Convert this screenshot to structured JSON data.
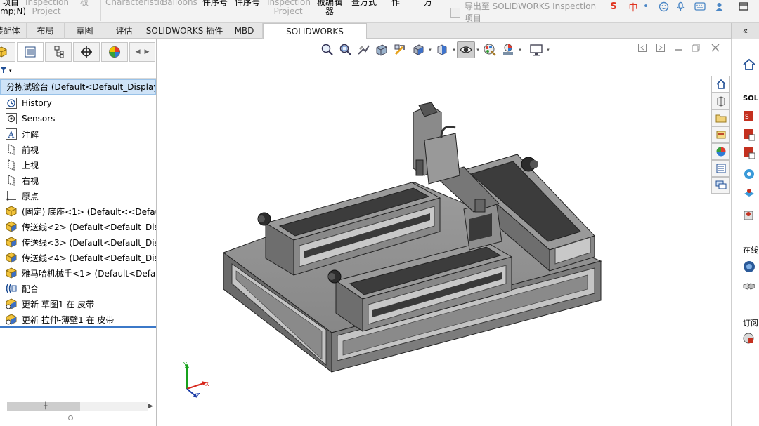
{
  "ribbon": {
    "items": [
      {
        "label": "项目\nmp;N)",
        "dim": false
      },
      {
        "label": "Inspection\nProject",
        "dim": true
      },
      {
        "label": "板",
        "dim": true
      },
      {
        "label": "Characteristic",
        "dim": true
      },
      {
        "label": "Balloons",
        "dim": true
      },
      {
        "label": "件序号",
        "dim": false
      },
      {
        "label": "件序号",
        "dim": false
      },
      {
        "label": "Inspection\nProject",
        "dim": true
      },
      {
        "label": "板编辑\n器",
        "dim": false
      },
      {
        "label": "查方式",
        "dim": false
      },
      {
        "label": "作",
        "dim": false
      },
      {
        "label": "方",
        "dim": false
      }
    ],
    "export_label": "导出至 SOLIDWORKS Inspection 项目",
    "sys_icons": [
      "sogou-ime-icon",
      "chinese-input-icon",
      "smile-icon",
      "microphone-icon",
      "keyboard-icon",
      "user-icon"
    ],
    "sys_text": {
      "s": "S",
      "zh": "中"
    }
  },
  "tabs": {
    "items": [
      "装配体",
      "布局",
      "草图",
      "评估",
      "SOLIDWORKS 插件",
      "MBD",
      "SOLIDWORKS Inspection"
    ],
    "active": 6,
    "collapse_icon": "«"
  },
  "manager": {
    "tabs": [
      "feature-manager-icon",
      "property-manager-icon",
      "configuration-manager-icon",
      "dimxpert-icon",
      "display-manager-icon"
    ],
    "filter_icon": "filter-icon",
    "root_label": "分拣试验台  (Default<Default_Display",
    "tree": [
      {
        "label": "History",
        "icon": "history-icon"
      },
      {
        "label": "Sensors",
        "icon": "sensors-icon"
      },
      {
        "label": "注解",
        "icon": "annotations-icon"
      },
      {
        "label": "前视",
        "icon": "plane-icon"
      },
      {
        "label": "上视",
        "icon": "plane-icon"
      },
      {
        "label": "右视",
        "icon": "plane-icon"
      },
      {
        "label": "原点",
        "icon": "origin-icon"
      },
      {
        "label": "(固定) 底座<1>  (Default<<Defaul",
        "icon": "part-icon"
      },
      {
        "label": "传送线<2>  (Default<Default_Disp",
        "icon": "subassembly-icon"
      },
      {
        "label": "传送线<3>  (Default<Default_Disp",
        "icon": "subassembly-icon"
      },
      {
        "label": "传送线<4>  (Default<Default_Disp",
        "icon": "subassembly-icon"
      },
      {
        "label": "雅马哈机械手<1>  (Default<Defau",
        "icon": "subassembly-icon"
      },
      {
        "label": "配合",
        "icon": "mates-icon"
      },
      {
        "label": "更新 草图1 在 皮带",
        "icon": "update-icon"
      },
      {
        "label": "更新 拉伸-薄壁1 在 皮带",
        "icon": "update-icon"
      }
    ]
  },
  "viewport": {
    "hud_icons": [
      "zoom-to-fit-icon",
      "zoom-to-area-icon",
      "previous-view-icon",
      "section-view-icon",
      "dynamic-annotation-icon",
      "view-orientation-icon",
      "display-style-icon",
      "hide-show-items-icon",
      "edit-appearance-icon",
      "apply-scene-icon",
      "view-settings-icon"
    ],
    "triad_labels": {
      "x": "X",
      "y": "Y",
      "z": "Z"
    }
  },
  "taskpane": {
    "tabs": [
      "home-icon",
      "solidworks-resources-icon",
      "design-library-icon",
      "file-explorer-icon",
      "view-palette-icon",
      "appearances-icon",
      "custom-properties-icon",
      "forum-icon"
    ],
    "labels": [
      "SOLI",
      "在线",
      "订阅"
    ]
  }
}
